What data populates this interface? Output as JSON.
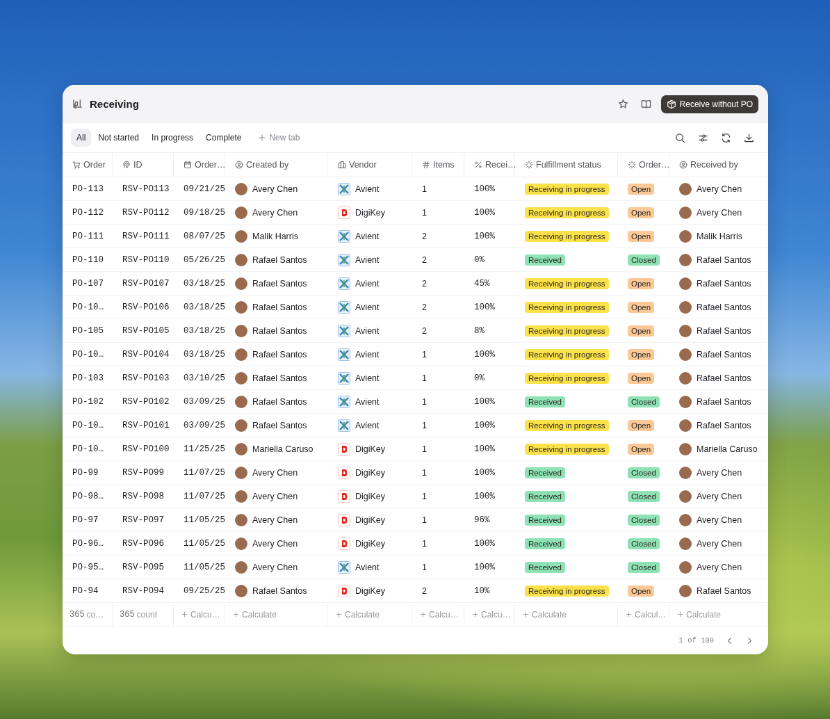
{
  "header": {
    "title": "Receiving",
    "action": "Receive without PO"
  },
  "tabs": [
    {
      "label": "All",
      "selected": true
    },
    {
      "label": "Not started",
      "selected": false
    },
    {
      "label": "In progress",
      "selected": false
    },
    {
      "label": "Complete",
      "selected": false
    }
  ],
  "new_tab": "New tab",
  "columns": [
    "Order",
    "ID",
    "Order…",
    "Created by",
    "Vendor",
    "Items",
    "Recei…",
    "Fulfillment status",
    "Order…",
    "Received by"
  ],
  "rows": [
    {
      "order": "PO-113",
      "id": "RSV-PO113",
      "date": "09/21/25",
      "created_by": "Avery Chen",
      "vendor": {
        "name": "Avient",
        "kind": "cross"
      },
      "items": "1",
      "received": "100%",
      "fulfillment": {
        "label": "Receiving in progress",
        "color": "#fbe14a"
      },
      "status": {
        "label": "Open",
        "color": "#fcc896"
      },
      "received_by": "Avery Chen"
    },
    {
      "order": "PO-112",
      "id": "RSV-PO112",
      "date": "09/18/25",
      "created_by": "Avery Chen",
      "vendor": {
        "name": "DigiKey",
        "kind": "block"
      },
      "items": "1",
      "received": "100%",
      "fulfillment": {
        "label": "Receiving in progress",
        "color": "#fbe14a"
      },
      "status": {
        "label": "Open",
        "color": "#fcc896"
      },
      "received_by": "Avery Chen"
    },
    {
      "order": "PO-111",
      "id": "RSV-PO111",
      "date": "08/07/25",
      "created_by": "Malik Harris",
      "vendor": {
        "name": "Avient",
        "kind": "cross"
      },
      "items": "2",
      "received": "100%",
      "fulfillment": {
        "label": "Receiving in progress",
        "color": "#fbe14a"
      },
      "status": {
        "label": "Open",
        "color": "#fcc896"
      },
      "received_by": "Malik Harris"
    },
    {
      "order": "PO-110",
      "id": "RSV-PO110",
      "date": "05/26/25",
      "created_by": "Rafael Santos",
      "vendor": {
        "name": "Avient",
        "kind": "cross"
      },
      "items": "2",
      "received": "0%",
      "fulfillment": {
        "label": "Received",
        "color": "#8ee2b4"
      },
      "status": {
        "label": "Closed",
        "color": "#8ee2b4"
      },
      "received_by": "Rafael Santos"
    },
    {
      "order": "PO-107",
      "id": "RSV-PO107",
      "date": "03/18/25",
      "created_by": "Rafael Santos",
      "vendor": {
        "name": "Avient",
        "kind": "cross"
      },
      "items": "2",
      "received": "45%",
      "fulfillment": {
        "label": "Receiving in progress",
        "color": "#fbe14a"
      },
      "status": {
        "label": "Open",
        "color": "#fcc896"
      },
      "received_by": "Rafael Santos"
    },
    {
      "order": "PO-10…",
      "id": "RSV-PO106",
      "date": "03/18/25",
      "created_by": "Rafael Santos",
      "vendor": {
        "name": "Avient",
        "kind": "cross"
      },
      "items": "2",
      "received": "100%",
      "fulfillment": {
        "label": "Receiving in progress",
        "color": "#fbe14a"
      },
      "status": {
        "label": "Open",
        "color": "#fcc896"
      },
      "received_by": "Rafael Santos"
    },
    {
      "order": "PO-105",
      "id": "RSV-PO105",
      "date": "03/18/25",
      "created_by": "Rafael Santos",
      "vendor": {
        "name": "Avient",
        "kind": "cross"
      },
      "items": "2",
      "received": "8%",
      "fulfillment": {
        "label": "Receiving in progress",
        "color": "#fbe14a"
      },
      "status": {
        "label": "Open",
        "color": "#fcc896"
      },
      "received_by": "Rafael Santos"
    },
    {
      "order": "PO-10…",
      "id": "RSV-PO104",
      "date": "03/18/25",
      "created_by": "Rafael Santos",
      "vendor": {
        "name": "Avient",
        "kind": "cross"
      },
      "items": "1",
      "received": "100%",
      "fulfillment": {
        "label": "Receiving in progress",
        "color": "#fbe14a"
      },
      "status": {
        "label": "Open",
        "color": "#fcc896"
      },
      "received_by": "Rafael Santos"
    },
    {
      "order": "PO-103",
      "id": "RSV-PO103",
      "date": "03/10/25",
      "created_by": "Rafael Santos",
      "vendor": {
        "name": "Avient",
        "kind": "cross"
      },
      "items": "1",
      "received": "0%",
      "fulfillment": {
        "label": "Receiving in progress",
        "color": "#fbe14a"
      },
      "status": {
        "label": "Open",
        "color": "#fcc896"
      },
      "received_by": "Rafael Santos"
    },
    {
      "order": "PO-102",
      "id": "RSV-PO102",
      "date": "03/09/25",
      "created_by": "Rafael Santos",
      "vendor": {
        "name": "Avient",
        "kind": "cross"
      },
      "items": "1",
      "received": "100%",
      "fulfillment": {
        "label": "Received",
        "color": "#8ee2b4"
      },
      "status": {
        "label": "Closed",
        "color": "#8ee2b4"
      },
      "received_by": "Rafael Santos"
    },
    {
      "order": "PO-10…",
      "id": "RSV-PO101",
      "date": "03/09/25",
      "created_by": "Rafael Santos",
      "vendor": {
        "name": "Avient",
        "kind": "cross"
      },
      "items": "1",
      "received": "100%",
      "fulfillment": {
        "label": "Receiving in progress",
        "color": "#fbe14a"
      },
      "status": {
        "label": "Open",
        "color": "#fcc896"
      },
      "received_by": "Rafael Santos"
    },
    {
      "order": "PO-10…",
      "id": "RSV-PO100",
      "date": "11/25/25",
      "created_by": "Mariella Caruso",
      "vendor": {
        "name": "DigiKey",
        "kind": "block"
      },
      "items": "1",
      "received": "100%",
      "fulfillment": {
        "label": "Receiving in progress",
        "color": "#fbe14a"
      },
      "status": {
        "label": "Open",
        "color": "#fcc896"
      },
      "received_by": "Mariella Caruso"
    },
    {
      "order": "PO-99",
      "id": "RSV-PO99",
      "date": "11/07/25",
      "created_by": "Avery Chen",
      "vendor": {
        "name": "DigiKey",
        "kind": "block"
      },
      "items": "1",
      "received": "100%",
      "fulfillment": {
        "label": "Received",
        "color": "#8ee2b4"
      },
      "status": {
        "label": "Closed",
        "color": "#8ee2b4"
      },
      "received_by": "Avery Chen"
    },
    {
      "order": "PO-98…",
      "id": "RSV-PO98",
      "date": "11/07/25",
      "created_by": "Avery Chen",
      "vendor": {
        "name": "DigiKey",
        "kind": "block"
      },
      "items": "1",
      "received": "100%",
      "fulfillment": {
        "label": "Received",
        "color": "#8ee2b4"
      },
      "status": {
        "label": "Closed",
        "color": "#8ee2b4"
      },
      "received_by": "Avery Chen"
    },
    {
      "order": "PO-97",
      "id": "RSV-PO97",
      "date": "11/05/25",
      "created_by": "Avery Chen",
      "vendor": {
        "name": "DigiKey",
        "kind": "block"
      },
      "items": "1",
      "received": "96%",
      "fulfillment": {
        "label": "Received",
        "color": "#8ee2b4"
      },
      "status": {
        "label": "Closed",
        "color": "#8ee2b4"
      },
      "received_by": "Avery Chen"
    },
    {
      "order": "PO-96…",
      "id": "RSV-PO96",
      "date": "11/05/25",
      "created_by": "Avery Chen",
      "vendor": {
        "name": "DigiKey",
        "kind": "block"
      },
      "items": "1",
      "received": "100%",
      "fulfillment": {
        "label": "Received",
        "color": "#8ee2b4"
      },
      "status": {
        "label": "Closed",
        "color": "#8ee2b4"
      },
      "received_by": "Avery Chen"
    },
    {
      "order": "PO-95…",
      "id": "RSV-PO95",
      "date": "11/05/25",
      "created_by": "Avery Chen",
      "vendor": {
        "name": "Avient",
        "kind": "cross"
      },
      "items": "1",
      "received": "100%",
      "fulfillment": {
        "label": "Received",
        "color": "#8ee2b4"
      },
      "status": {
        "label": "Closed",
        "color": "#8ee2b4"
      },
      "received_by": "Avery Chen"
    },
    {
      "order": "PO-94",
      "id": "RSV-PO94",
      "date": "09/25/25",
      "created_by": "Rafael Santos",
      "vendor": {
        "name": "DigiKey",
        "kind": "block"
      },
      "items": "2",
      "received": "10%",
      "fulfillment": {
        "label": "Receiving in progress",
        "color": "#fbe14a"
      },
      "status": {
        "label": "Open",
        "color": "#fcc896"
      },
      "received_by": "Rafael Santos"
    }
  ],
  "footer": [
    {
      "kind": "count",
      "number": "365",
      "label": "co…"
    },
    {
      "kind": "count",
      "number": "365",
      "label": "count"
    },
    {
      "kind": "calculate",
      "label": "Calcu…"
    },
    {
      "kind": "calculate",
      "label": "Calculate"
    },
    {
      "kind": "calculate",
      "label": "Calculate"
    },
    {
      "kind": "calculate",
      "label": "Calcu…"
    },
    {
      "kind": "calculate",
      "label": "Calcu…"
    },
    {
      "kind": "calculate",
      "label": "Calculate"
    },
    {
      "kind": "calculate",
      "label": "Calcul…"
    },
    {
      "kind": "calculate",
      "label": "Calculate"
    }
  ],
  "pagination": {
    "label": "1 of 100"
  }
}
